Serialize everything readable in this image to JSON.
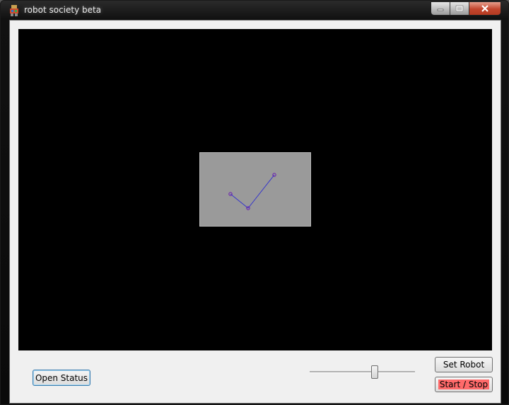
{
  "window": {
    "title": "robot society beta"
  },
  "title_controls": {
    "minimize_icon": "minimize-icon",
    "maximize_icon": "maximize-icon",
    "close_icon": "close-icon"
  },
  "canvas": {
    "background": "#000000",
    "grid_background": "#9a9a9a",
    "robot_link_color": "#3333cc",
    "robot_joint_color": "#6a1ab0"
  },
  "controls": {
    "open_status_label": "Open Status",
    "set_robot_label": "Set Robot",
    "start_stop_label": "Start / Stop",
    "start_stop_highlight": "#ff6a6a",
    "speed_slider_value": 0.62
  }
}
